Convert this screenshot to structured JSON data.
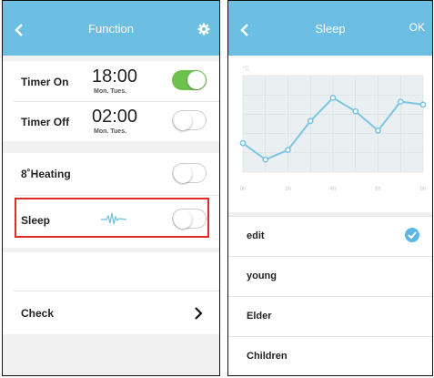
{
  "left": {
    "header": {
      "title": "Function",
      "back_icon": "chevron-left-icon",
      "settings_icon": "gear-icon"
    },
    "timer_on": {
      "label": "Timer On",
      "time": "18:00",
      "days": "Mon. Tues.",
      "toggle": "on"
    },
    "timer_off": {
      "label": "Timer Off",
      "time": "02:00",
      "days": "Mon. Tues.",
      "toggle": "off"
    },
    "heating": {
      "label": "8˚Heating",
      "toggle": "off"
    },
    "sleep": {
      "label": "Sleep",
      "icon": "wave-icon",
      "toggle": "off"
    },
    "check": {
      "label": "Check",
      "icon": "chevron-right-icon"
    }
  },
  "right": {
    "header": {
      "title": "Sleep",
      "ok_label": "OK",
      "back_icon": "chevron-left-icon"
    },
    "chart_data": {
      "type": "line",
      "ylabel": "°C",
      "x": [
        "0h",
        "1h",
        "2h",
        "3h",
        "4h",
        "5h",
        "6h",
        "7h",
        "8h"
      ],
      "tick_labels": [
        "0h",
        "2h",
        "4h",
        "6h",
        "8h"
      ],
      "values": [
        3.0,
        1.3,
        2.3,
        5.3,
        7.7,
        6.3,
        4.3,
        7.3,
        7.0
      ],
      "ylim": [
        0,
        10
      ],
      "grid": true,
      "line_color": "#7ec5e3",
      "fill_color": "#eaf0f1"
    },
    "options": [
      {
        "label": "edit",
        "selected": true
      },
      {
        "label": "young",
        "selected": false
      },
      {
        "label": "Elder",
        "selected": false
      },
      {
        "label": "Children",
        "selected": false
      }
    ]
  },
  "colors": {
    "header": "#6cbfe2",
    "toggle_on": "#6cc24a",
    "highlight": "#e02b2b",
    "check": "#5ab7e6"
  }
}
